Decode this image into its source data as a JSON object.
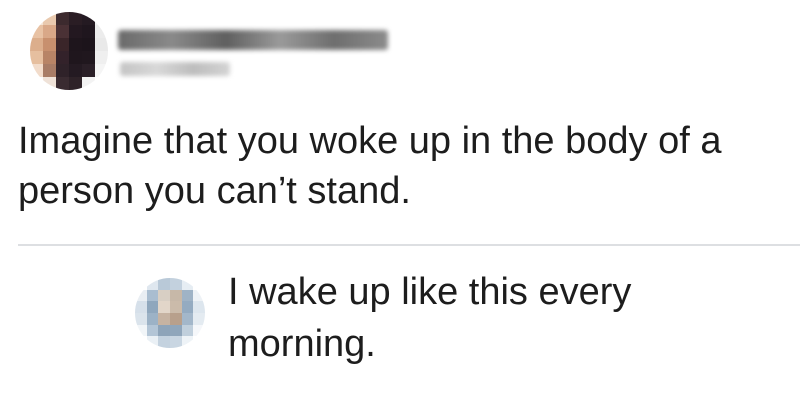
{
  "post": {
    "author_name": "",
    "timestamp": "",
    "text": "Imagine that you woke up in the body of a person you can’t stand."
  },
  "reply": {
    "author_name": "",
    "text": "I wake up like this every morning."
  },
  "colors": {
    "background": "#ffffff",
    "text": "#1d1d1d",
    "divider": "#dddfe2"
  },
  "icons": {
    "post_avatar": "user-avatar-pixelated",
    "reply_avatar": "user-avatar-pixelated"
  }
}
